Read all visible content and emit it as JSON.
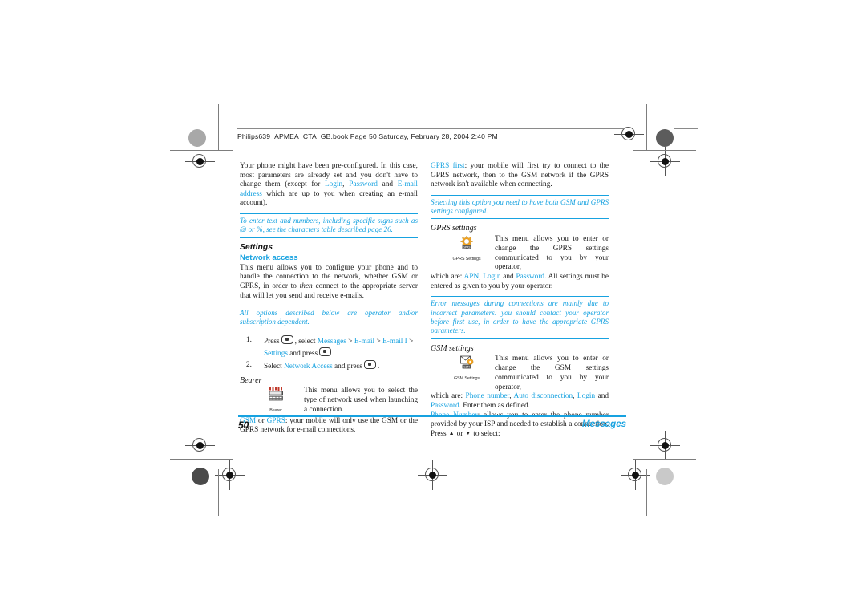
{
  "header": {
    "text": "Philips639_APMEA_CTA_GB.book  Page 50  Saturday, February 28, 2004  2:40 PM"
  },
  "left_column": {
    "intro": {
      "part1": "Your phone might have been pre-configured. In this case, most parameters are already set and you don't have to change them (except for ",
      "link1": "Login",
      "sep1": ", ",
      "link2": "Password",
      "sep2": " and ",
      "link3": "E-mail address",
      "part2": " which are up to you when creating an e-mail account)."
    },
    "note1": "To enter text and numbers, including specific signs such as @ or %, see the characters table described page 26.",
    "settings_heading": "Settings",
    "network_access_heading": "Network access",
    "network_access_body": "This menu allows you to configure your phone and to handle the connection to the network, whether GSM or GPRS, in order to then connect to the appropriate server that will let you send and receive e-mails.",
    "network_access_body_pre": "This menu allows you to configure your phone and to handle the connection to the network, whether GSM or GPRS, in order to ",
    "network_access_body_italic": "then",
    "network_access_body_post": " connect to the appropriate server that will let you send and receive e-mails.",
    "note2": "All options described below are operator and/or subscription dependent.",
    "steps": [
      {
        "num": "1.",
        "pre": "Press",
        "mid": ", select ",
        "path1": "Messages",
        "gt1": " > ",
        "path2": "E-mail",
        "gt2": " > ",
        "path3": "E-mail I",
        "gt3": " > ",
        "path4": "Settings",
        "post": " and press",
        "end": "."
      },
      {
        "num": "2.",
        "pre": "Select",
        "path1": "Network Access",
        "post": " and press",
        "end": "."
      }
    ],
    "bearer_heading": "Bearer",
    "bearer_icon_label": "Bearer",
    "bearer_icon_name": "bearer-antenna-icon",
    "bearer_body": "This menu allows you to select the type of network used when launching a connection.",
    "bearer_opt1": "GSM",
    "bearer_or": " or ",
    "bearer_opt2": "GPRS",
    "bearer_opt_body": ": your mobile will only use the GSM or the GPRS network for e-mail connections."
  },
  "right_column": {
    "gprs_first_label": "GPRS first",
    "gprs_first_body": ": your mobile will first try to connect to the GPRS network, then to the GSM network if the GPRS network isn't available when connecting.",
    "note3": "Selecting this option you need to have both GSM and GPRS settings configured.",
    "gprs_settings_heading": "GPRS settings",
    "gprs_icon_label": "GPRS Settings",
    "gprs_icon_name": "gprs-settings-icon",
    "gprs_body_1": "This menu allows you to enter or change the GPRS settings communicated to you by your operator,",
    "gprs_body_2_pre": "which are: ",
    "gprs_apn": "APN",
    "gprs_sep1": ", ",
    "gprs_login": "Login",
    "gprs_sep2": " and ",
    "gprs_password": "Password",
    "gprs_body_2_post": ". All settings must be entered as given to you by your operator.",
    "note4": "Error messages during connections are mainly due to incorrect parameters: you should contact your operator before first use, in order to have the appropriate GPRS parameters.",
    "gsm_settings_heading": "GSM settings",
    "gsm_icon_label": "GSM Settings",
    "gsm_icon_name": "gsm-settings-icon",
    "gsm_body_1": "This menu allows you to enter or change the GSM settings communicated to you by your operator,",
    "gsm_body_2_pre": "which are: ",
    "gsm_phone_number": "Phone number",
    "gsm_sep1": ", ",
    "gsm_auto_disconnection": "Auto disconnection",
    "gsm_sep2": ", ",
    "gsm_login": "Login",
    "gsm_sep3": " and ",
    "gsm_password": "Password",
    "gsm_body_2_post": ". Enter them as defined.",
    "phone_number_label": "Phone Number",
    "phone_number_body_pre": ": allows you to enter the phone number provided by your ISP and needed to establish a connection. Press",
    "phone_number_or": "or",
    "phone_number_body_post": "to select:"
  },
  "footer": {
    "page_number": "50",
    "section": "Messages"
  },
  "colors": {
    "accent_blue": "#17a2e0",
    "text": "#1a1a1a",
    "mark_grey": "#7d7d7d"
  }
}
